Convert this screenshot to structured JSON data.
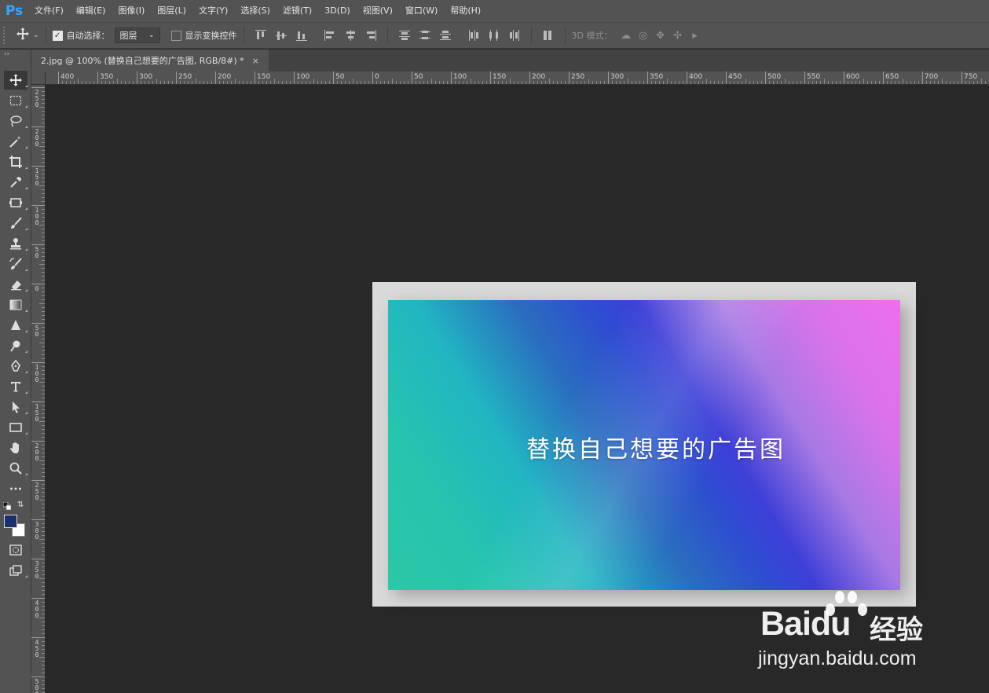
{
  "app": {
    "logo_text": "Ps"
  },
  "menu": [
    "文件(F)",
    "编辑(E)",
    "图像(I)",
    "图层(L)",
    "文字(Y)",
    "选择(S)",
    "滤镜(T)",
    "3D(D)",
    "视图(V)",
    "窗口(W)",
    "帮助(H)"
  ],
  "options_bar": {
    "auto_select_label": "自动选择：",
    "auto_select_checked": true,
    "auto_select_target": "图层",
    "show_transform_label": "显示变换控件",
    "show_transform_checked": false,
    "mode_3d_label": "3D 模式："
  },
  "document_tab": {
    "title": "2.jpg @ 100% (替换自己想要的广告图, RGB/8#) *",
    "close_glyph": "×"
  },
  "toolbar": {
    "collapse_glyph": "››",
    "foreground_color": "#1a2f6b",
    "background_color": "#ffffff"
  },
  "ruler": {
    "top_labels": [
      "400",
      "350",
      "300",
      "250",
      "200",
      "150",
      "100",
      "50",
      "0",
      "50",
      "100",
      "150",
      "200",
      "250",
      "300",
      "350",
      "400",
      "450",
      "500",
      "550",
      "600",
      "650",
      "700",
      "750"
    ],
    "left_labels": [
      "250",
      "200",
      "150",
      "100",
      "50",
      "0",
      "50",
      "100",
      "150",
      "200",
      "250",
      "300",
      "350",
      "400",
      "450",
      "500"
    ]
  },
  "canvas": {
    "banner_text": "替换自己想要的广告图",
    "frame_color": "#d9d9d9",
    "gradient_colors": [
      "#ee6eee",
      "#3d3fd8",
      "#2a6ebf",
      "#21b5c2",
      "#2cc7a5"
    ]
  },
  "watermark": {
    "logo_text": "Baidu",
    "cn_text": "经验",
    "url_text": "jingyan.baidu.com"
  }
}
